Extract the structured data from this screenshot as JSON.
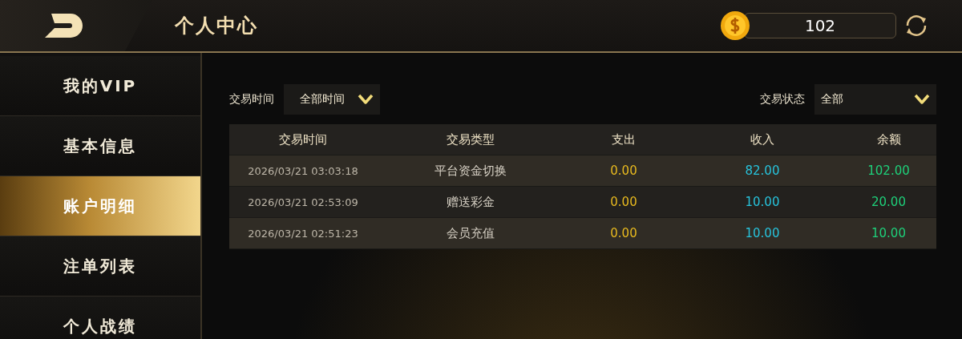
{
  "header": {
    "back_label": "个人中心",
    "balance": "102"
  },
  "sidebar": {
    "items": [
      {
        "label": "我的VIP",
        "selected": false
      },
      {
        "label": "基本信息",
        "selected": false
      },
      {
        "label": "账户明细",
        "selected": true
      },
      {
        "label": "注单列表",
        "selected": false
      },
      {
        "label": "个人战绩",
        "selected": false
      }
    ]
  },
  "filters": {
    "time_label": "交易时间",
    "time_value": "全部时间",
    "status_label": "交易状态",
    "status_value": "全部"
  },
  "table": {
    "columns": [
      {
        "label": "交易时间",
        "kind": "time"
      },
      {
        "label": "交易类型",
        "kind": "type"
      },
      {
        "label": "支出",
        "kind": "expense"
      },
      {
        "label": "收入",
        "kind": "income"
      },
      {
        "label": "余额",
        "kind": "balance"
      }
    ],
    "rows": [
      [
        "2026/03/21 03:03:18",
        "平台资金切换",
        "0.00",
        "82.00",
        "102.00"
      ],
      [
        "2026/03/21 02:53:09",
        "赠送彩金",
        "0.00",
        "10.00",
        "20.00"
      ],
      [
        "2026/03/21 02:51:23",
        "会员充值",
        "0.00",
        "10.00",
        "10.00"
      ]
    ]
  }
}
